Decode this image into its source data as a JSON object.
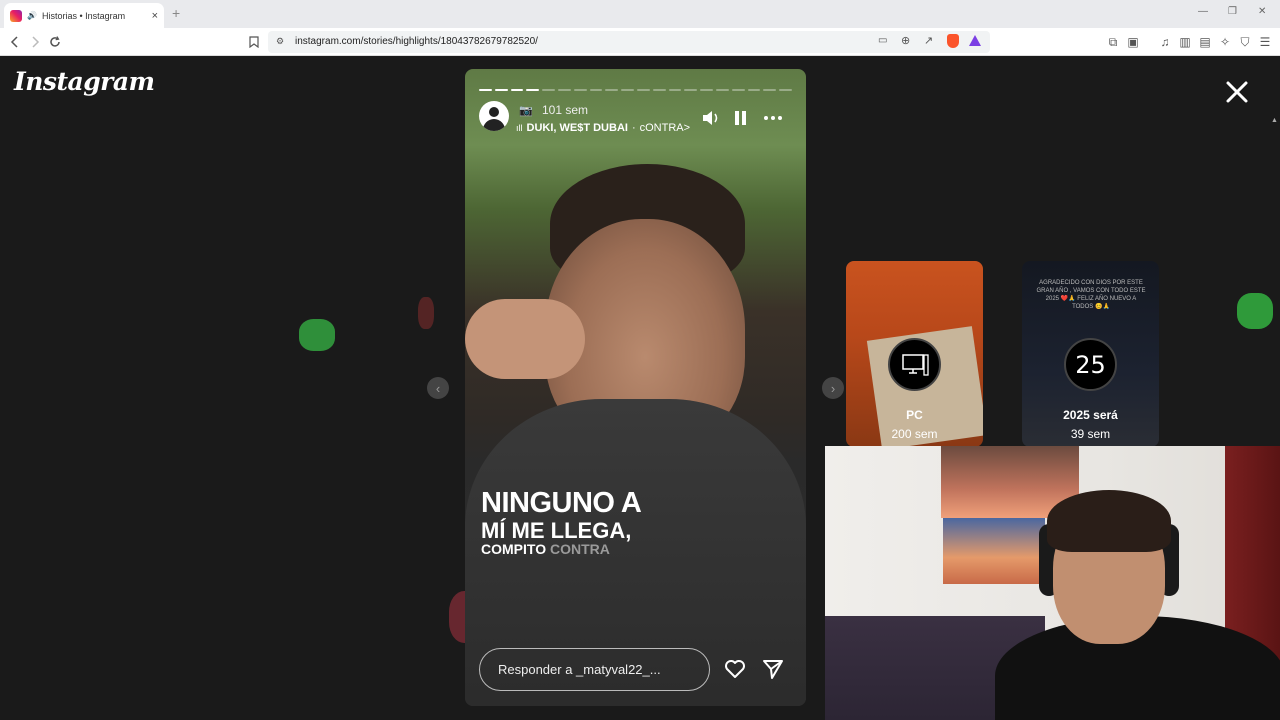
{
  "browser": {
    "tab_title": "Historias • Instagram",
    "tab_close": "×",
    "new_tab": "+",
    "url": "instagram.com/stories/highlights/18043782679782520/",
    "window_controls": [
      "—",
      "❐",
      "✕"
    ]
  },
  "instagram": {
    "logo_text": "Instagram",
    "story": {
      "progress_total": 20,
      "progress_done": 4,
      "time_ago": "101 sem",
      "music_artist": "DUKI, WE$T DUBAI",
      "music_separator": "·",
      "music_song": "cONTRA>",
      "caption_line1": "NINGUNO A",
      "caption_line2": "MÍ ME LLEGA,",
      "caption_line3_a": "COMPITO ",
      "caption_line3_b": "CONTRA",
      "reply_placeholder": "Responder a _matyval22_..."
    },
    "highlights": [
      {
        "title": "PC",
        "time": "200 sem",
        "icon": "computer-icon"
      },
      {
        "title": "2025 será",
        "time": "39 sem",
        "circle_text": "25",
        "preview_text": "AGRADECIDO CON DIOS POR ESTE GRAN AÑO , VAMOS CON TODO ESTE 2025 ❤️🙏 FELIZ AÑO NUEVO A TODOS 😊🙏"
      }
    ],
    "nav": {
      "prev": "‹",
      "next": "›"
    }
  },
  "colors": {
    "page_bg": "#1a1a1a",
    "highlight_pc_bg": "#c9531f",
    "highlight_2025_bg": "#141821"
  }
}
